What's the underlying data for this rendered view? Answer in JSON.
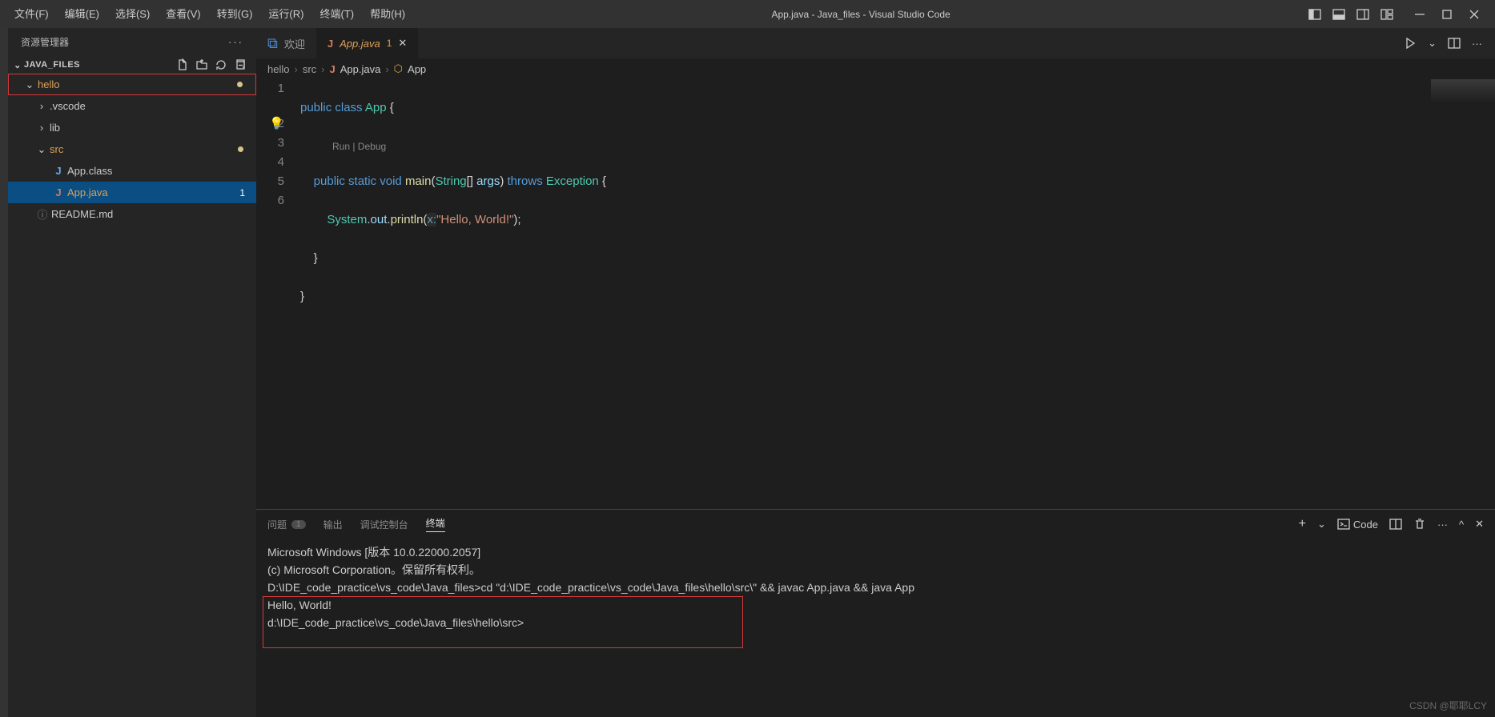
{
  "titlebar": {
    "menus": [
      "文件(F)",
      "编辑(E)",
      "选择(S)",
      "查看(V)",
      "转到(G)",
      "运行(R)",
      "终端(T)",
      "帮助(H)"
    ],
    "title": "App.java - Java_files - Visual Studio Code"
  },
  "sidebar": {
    "header": "资源管理器",
    "section": "JAVA_FILES",
    "tree": {
      "hello": "hello",
      "vscode": ".vscode",
      "lib": "lib",
      "src": "src",
      "appclass": "App.class",
      "appjava": "App.java",
      "appjava_badge": "1",
      "readme": "README.md"
    }
  },
  "tabs": {
    "welcome": "欢迎",
    "appjava": "App.java",
    "appjava_mod": "1"
  },
  "breadcrumb": {
    "p1": "hello",
    "p2": "src",
    "p3": "App.java",
    "p4": "App"
  },
  "code": {
    "codelens": "Run | Debug",
    "line1": {
      "kw1": "public",
      "kw2": "class",
      "cls": "App",
      "brace": "{"
    },
    "line2": {
      "kw1": "public",
      "kw2": "static",
      "kw3": "void",
      "fn": "main",
      "p1": "(",
      "ty": "String",
      "br": "[]",
      "arg": "args",
      "p2": ")",
      "kw4": "throws",
      "ex": "Exception",
      "brace": "{"
    },
    "line3": {
      "obj": "System",
      "dot1": ".",
      "out": "out",
      "dot2": ".",
      "fn": "println",
      "p1": "(",
      "hint": "x:",
      "str": "\"Hello, World!\"",
      "p2": ");"
    },
    "line4": "    }",
    "line5": "}"
  },
  "panel": {
    "tabs": {
      "problems": "问题",
      "problems_badge": "1",
      "output": "输出",
      "debug": "调试控制台",
      "terminal": "终端"
    },
    "action_code": "Code",
    "terminal_lines": [
      "Microsoft Windows [版本 10.0.22000.2057]",
      "(c) Microsoft Corporation。保留所有权利。",
      "",
      "D:\\IDE_code_practice\\vs_code\\Java_files>cd \"d:\\IDE_code_practice\\vs_code\\Java_files\\hello\\src\\\" && javac App.java && java App",
      "Hello, World!",
      "",
      "d:\\IDE_code_practice\\vs_code\\Java_files\\hello\\src>"
    ]
  },
  "watermark": "CSDN @耶耶LCY"
}
